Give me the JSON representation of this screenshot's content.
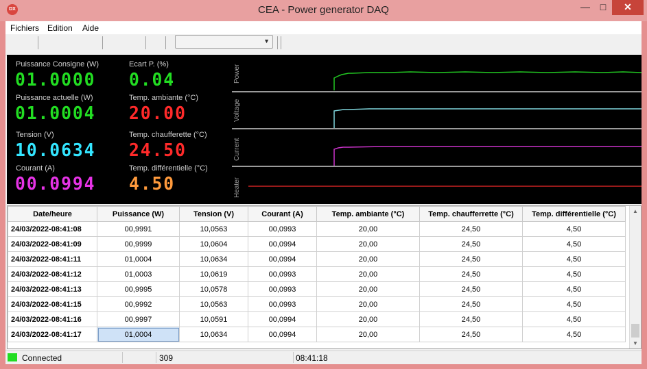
{
  "window": {
    "title": "CEA - Power generator DAQ",
    "icon_text": "DX",
    "min_glyph": "—",
    "max_glyph": "□",
    "close_glyph": "✕"
  },
  "menu": {
    "items": [
      "Fichiers",
      "Edition",
      "Aide"
    ]
  },
  "toolbar": {
    "combo_value": ""
  },
  "readouts": {
    "puissance_consigne": {
      "label": "Puissance Consigne (W)",
      "value": "01.0000",
      "color": "#22dd22"
    },
    "ecart_p": {
      "label": "Ecart P. (%)",
      "value": "0.04",
      "color": "#22dd22"
    },
    "puissance_actuelle": {
      "label": "Puissance actuelle (W)",
      "value": "01.0004",
      "color": "#22dd22"
    },
    "temp_ambiante": {
      "label": "Temp. ambiante (°C)",
      "value": "20.00",
      "color": "#ff2a2a"
    },
    "tension": {
      "label": "Tension (V)",
      "value": "10.0634",
      "color": "#33e5ff"
    },
    "temp_chaufferette": {
      "label": "Temp. chaufferette (°C)",
      "value": "24.50",
      "color": "#ff2a2a"
    },
    "courant": {
      "label": "Courant (A)",
      "value": "00.0994",
      "color": "#e633e6"
    },
    "temp_differentielle": {
      "label": "Temp. différentielle (°C)",
      "value": "4.50",
      "color": "#ff9a3c"
    }
  },
  "graphs": {
    "bands": [
      {
        "name": "Power",
        "color": "#22c822"
      },
      {
        "name": "Voltage",
        "color": "#7fd6dc"
      },
      {
        "name": "Current",
        "color": "#cc33cc"
      },
      {
        "name": "Heater",
        "color": "#cc2222"
      }
    ]
  },
  "table": {
    "headers": [
      "Date/heure",
      "Puissance (W)",
      "Tension (V)",
      "Courant (A)",
      "Temp. ambiante (°C)",
      "Temp. chaufferrette (°C)",
      "Temp. différentielle (°C)"
    ],
    "rows": [
      [
        "24/03/2022-08:41:08",
        "00,9991",
        "10,0563",
        "00,0993",
        "20,00",
        "24,50",
        "4,50"
      ],
      [
        "24/03/2022-08:41:09",
        "00,9999",
        "10,0604",
        "00,0994",
        "20,00",
        "24,50",
        "4,50"
      ],
      [
        "24/03/2022-08:41:11",
        "01,0004",
        "10,0634",
        "00,0994",
        "20,00",
        "24,50",
        "4,50"
      ],
      [
        "24/03/2022-08:41:12",
        "01,0003",
        "10,0619",
        "00,0993",
        "20,00",
        "24,50",
        "4,50"
      ],
      [
        "24/03/2022-08:41:13",
        "00,9995",
        "10,0578",
        "00,0993",
        "20,00",
        "24,50",
        "4,50"
      ],
      [
        "24/03/2022-08:41:15",
        "00,9992",
        "10,0563",
        "00,0993",
        "20,00",
        "24,50",
        "4,50"
      ],
      [
        "24/03/2022-08:41:16",
        "00,9997",
        "10,0591",
        "00,0994",
        "20,00",
        "24,50",
        "4,50"
      ],
      [
        "24/03/2022-08:41:17",
        "01,0004",
        "10,0634",
        "00,0994",
        "20,00",
        "24,50",
        "4,50"
      ]
    ]
  },
  "status": {
    "connection": "Connected",
    "count": "309",
    "time": "08:41:18",
    "led_color": "#22dd22"
  }
}
